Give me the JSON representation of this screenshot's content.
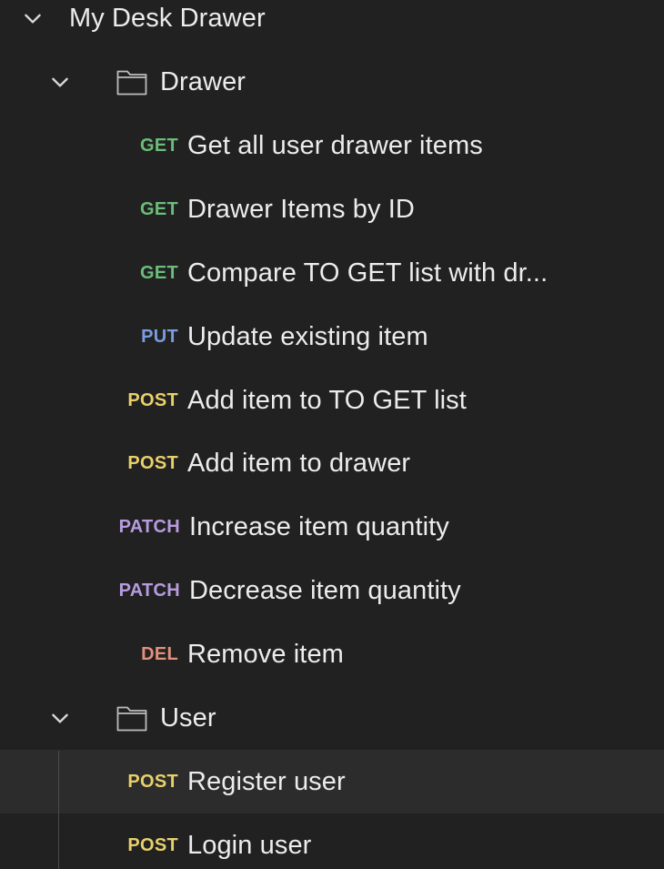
{
  "collection": {
    "name": "My Desk Drawer",
    "expanded": true,
    "folders": [
      {
        "name": "Drawer",
        "expanded": true,
        "icon": "folder-icon",
        "requests": [
          {
            "method": "GET",
            "name": "Get all user drawer items"
          },
          {
            "method": "GET",
            "name": "Drawer Items by ID"
          },
          {
            "method": "GET",
            "name": "Compare TO GET list with dr..."
          },
          {
            "method": "PUT",
            "name": "Update existing item"
          },
          {
            "method": "POST",
            "name": "Add item to TO GET list"
          },
          {
            "method": "POST",
            "name": "Add item to drawer"
          },
          {
            "method": "PATCH",
            "name": "Increase item quantity"
          },
          {
            "method": "PATCH",
            "name": "Decrease item quantity"
          },
          {
            "method": "DEL",
            "name": "Remove item"
          }
        ]
      },
      {
        "name": "User",
        "expanded": true,
        "icon": "folder-icon",
        "requests": [
          {
            "method": "POST",
            "name": "Register user",
            "hovered": true
          },
          {
            "method": "POST",
            "name": "Login user"
          }
        ]
      }
    ]
  },
  "colors": {
    "background": "#212121",
    "hover_row": "#2c2c2c",
    "text": "#ececec",
    "GET": "#6bbd79",
    "PUT": "#7a9ce0",
    "POST": "#e8d06a",
    "PATCH": "#b79be0",
    "DEL": "#e0907c"
  }
}
